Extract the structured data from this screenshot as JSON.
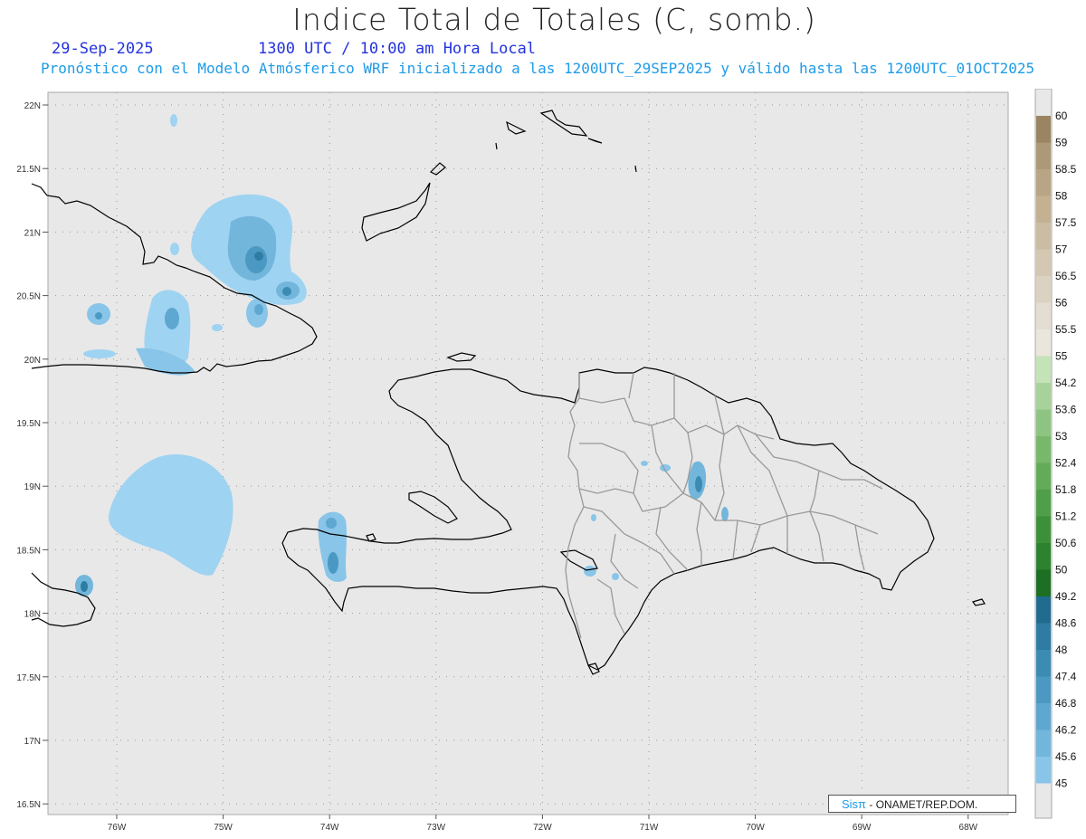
{
  "header": {
    "title": "Indice Total de Totales (C, somb.)",
    "date": "29-Sep-2025",
    "hour": "1300 UTC / 10:00 am Hora Local",
    "subtitle": "Pronóstico con el Modelo Atmósferico WRF inicializado a las 1200UTC_29SEP2025 y válido hasta las  1200UTC_01OCT2025"
  },
  "map": {
    "lat_labels": [
      "22N",
      "21.5N",
      "21N",
      "20.5N",
      "20N",
      "19.5N",
      "19N",
      "18.5N",
      "18N",
      "17.5N",
      "17N",
      "16.5N"
    ],
    "lon_labels": [
      "76W",
      "75W",
      "74W",
      "73W",
      "72W",
      "71W",
      "70W",
      "69W",
      "68W"
    ],
    "background_color": "#e8e8e8",
    "coast_color": "#000000",
    "province_border_color": "#999999"
  },
  "colorbar": {
    "levels": [
      "60",
      "59",
      "58.5",
      "58",
      "57.5",
      "57",
      "56.5",
      "56",
      "55.5",
      "55",
      "54.2",
      "53.6",
      "53",
      "52.4",
      "51.8",
      "51.2",
      "50.6",
      "50",
      "49.2",
      "48.6",
      "48",
      "47.4",
      "46.8",
      "46.2",
      "45.6",
      "45"
    ],
    "colors": [
      "#9a8462",
      "#ad9878",
      "#b9a585",
      "#c3b192",
      "#cbbda3",
      "#d4c8b2",
      "#dcd2c2",
      "#e3ddd2",
      "#eae6dc",
      "#c4e3b8",
      "#a7d39a",
      "#8ec481",
      "#77b86a",
      "#63ab59",
      "#4f9e49",
      "#3d903a",
      "#2d822f",
      "#1d6f23",
      "#216b8f",
      "#2e7ca3",
      "#3c8bb3",
      "#4b99c2",
      "#5ea7d0",
      "#72b6dc",
      "#88c5e8",
      "#9fd3f2"
    ]
  },
  "credit": {
    "brand": "Sisπ",
    "text": "- ONAMET/REP.DOM."
  }
}
